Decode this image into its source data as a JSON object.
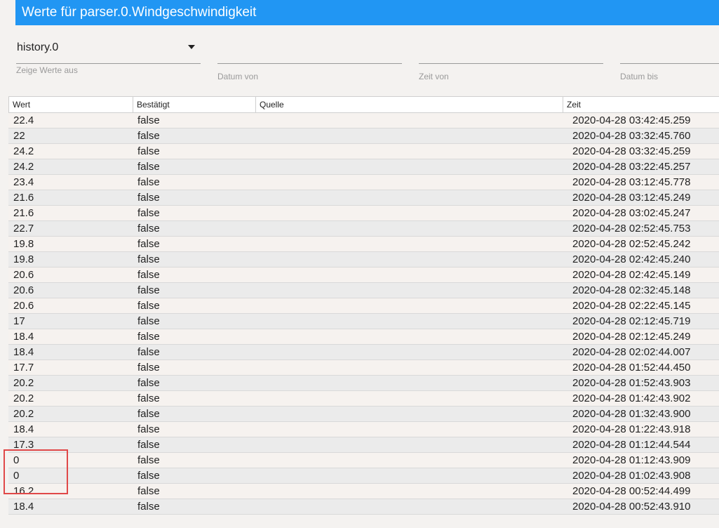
{
  "header": {
    "title": "Werte für parser.0.Windgeschwindigkeit"
  },
  "filters": {
    "instance": {
      "value": "history.0",
      "label": "Zeige Werte aus"
    },
    "date_from_label": "Datum von",
    "time_from_label": "Zeit von",
    "date_to_label": "Datum bis"
  },
  "table": {
    "columns": [
      "Wert",
      "Bestätigt",
      "Quelle",
      "Zeit"
    ],
    "rows": [
      {
        "wert": "22.4",
        "bestaetigt": "false",
        "quelle": "",
        "zeit": "2020-04-28 03:42:45.259"
      },
      {
        "wert": "22",
        "bestaetigt": "false",
        "quelle": "",
        "zeit": "2020-04-28 03:32:45.760"
      },
      {
        "wert": "24.2",
        "bestaetigt": "false",
        "quelle": "",
        "zeit": "2020-04-28 03:32:45.259"
      },
      {
        "wert": "24.2",
        "bestaetigt": "false",
        "quelle": "",
        "zeit": "2020-04-28 03:22:45.257"
      },
      {
        "wert": "23.4",
        "bestaetigt": "false",
        "quelle": "",
        "zeit": "2020-04-28 03:12:45.778"
      },
      {
        "wert": "21.6",
        "bestaetigt": "false",
        "quelle": "",
        "zeit": "2020-04-28 03:12:45.249"
      },
      {
        "wert": "21.6",
        "bestaetigt": "false",
        "quelle": "",
        "zeit": "2020-04-28 03:02:45.247"
      },
      {
        "wert": "22.7",
        "bestaetigt": "false",
        "quelle": "",
        "zeit": "2020-04-28 02:52:45.753"
      },
      {
        "wert": "19.8",
        "bestaetigt": "false",
        "quelle": "",
        "zeit": "2020-04-28 02:52:45.242"
      },
      {
        "wert": "19.8",
        "bestaetigt": "false",
        "quelle": "",
        "zeit": "2020-04-28 02:42:45.240"
      },
      {
        "wert": "20.6",
        "bestaetigt": "false",
        "quelle": "",
        "zeit": "2020-04-28 02:42:45.149"
      },
      {
        "wert": "20.6",
        "bestaetigt": "false",
        "quelle": "",
        "zeit": "2020-04-28 02:32:45.148"
      },
      {
        "wert": "20.6",
        "bestaetigt": "false",
        "quelle": "",
        "zeit": "2020-04-28 02:22:45.145"
      },
      {
        "wert": "17",
        "bestaetigt": "false",
        "quelle": "",
        "zeit": "2020-04-28 02:12:45.719"
      },
      {
        "wert": "18.4",
        "bestaetigt": "false",
        "quelle": "",
        "zeit": "2020-04-28 02:12:45.249"
      },
      {
        "wert": "18.4",
        "bestaetigt": "false",
        "quelle": "",
        "zeit": "2020-04-28 02:02:44.007"
      },
      {
        "wert": "17.7",
        "bestaetigt": "false",
        "quelle": "",
        "zeit": "2020-04-28 01:52:44.450"
      },
      {
        "wert": "20.2",
        "bestaetigt": "false",
        "quelle": "",
        "zeit": "2020-04-28 01:52:43.903"
      },
      {
        "wert": "20.2",
        "bestaetigt": "false",
        "quelle": "",
        "zeit": "2020-04-28 01:42:43.902"
      },
      {
        "wert": "20.2",
        "bestaetigt": "false",
        "quelle": "",
        "zeit": "2020-04-28 01:32:43.900"
      },
      {
        "wert": "18.4",
        "bestaetigt": "false",
        "quelle": "",
        "zeit": "2020-04-28 01:22:43.918"
      },
      {
        "wert": "17.3",
        "bestaetigt": "false",
        "quelle": "",
        "zeit": "2020-04-28 01:12:44.544"
      },
      {
        "wert": "0",
        "bestaetigt": "false",
        "quelle": "",
        "zeit": "2020-04-28 01:12:43.909"
      },
      {
        "wert": "0",
        "bestaetigt": "false",
        "quelle": "",
        "zeit": "2020-04-28 01:02:43.908"
      },
      {
        "wert": "16.2",
        "bestaetigt": "false",
        "quelle": "",
        "zeit": "2020-04-28 00:52:44.499"
      },
      {
        "wert": "18.4",
        "bestaetigt": "false",
        "quelle": "",
        "zeit": "2020-04-28 00:52:43.910"
      }
    ]
  },
  "colors": {
    "header_bg": "#2196f3",
    "page_bg": "#f4f2f0",
    "highlight": "#e04848"
  }
}
